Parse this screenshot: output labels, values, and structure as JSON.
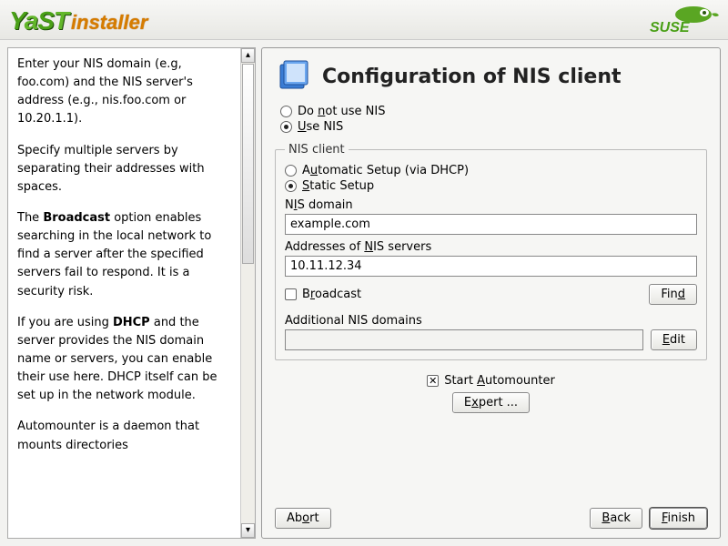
{
  "header": {
    "brand_a": "YaST",
    "brand_b": "installer",
    "suse": "SUSE"
  },
  "help": {
    "p1_a": "Enter your NIS domain (e.g, foo.com) and the NIS server's address (e.g., nis.foo.com or 10.20.1.1).",
    "p2": "Specify multiple servers by separating their addresses with spaces.",
    "p3_a": "The ",
    "p3_b": "Broadcast",
    "p3_c": " option enables searching in the local network to find a server after the specified servers fail to respond. It is a security risk.",
    "p4_a": "If you are using ",
    "p4_b": "DHCP",
    "p4_c": " and the server provides the NIS domain name or servers, you can enable their use here. DHCP itself can be set up in the network module.",
    "p5": "Automounter is a daemon that mounts directories"
  },
  "main": {
    "title": "Configuration of NIS client",
    "opt_disable": "Do not use NIS",
    "opt_enable": "Use NIS",
    "use_nis_selected": true,
    "group_label": "NIS client",
    "setup_auto": "Automatic Setup (via DHCP)",
    "setup_static": "Static Setup",
    "static_selected": true,
    "domain_label": "NIS domain",
    "domain_value": "example.com",
    "servers_label": "Addresses of NIS servers",
    "servers_value": "10.11.12.34",
    "broadcast_label": "Broadcast",
    "broadcast_checked": false,
    "find_label": "Find",
    "addl_label": "Additional NIS domains",
    "addl_value": "",
    "edit_label": "Edit",
    "automounter_label": "Start Automounter",
    "automounter_checked": true,
    "expert_label": "Expert ..."
  },
  "buttons": {
    "abort": "Abort",
    "back": "Back",
    "finish": "Finish"
  },
  "underlines": {
    "not": "n",
    "use": "U",
    "auto": "u",
    "static": "S",
    "domain": "I",
    "servers": "N",
    "broadcast": "r",
    "find": "d",
    "edit": "E",
    "automount": "A",
    "expert": "x",
    "abort": "o",
    "back": "B",
    "finish": "F"
  }
}
